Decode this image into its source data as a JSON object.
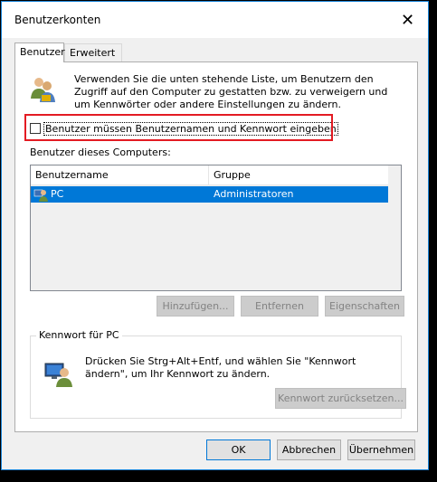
{
  "window": {
    "title": "Benutzerkonten"
  },
  "tabs": [
    {
      "label": "Benutzer"
    },
    {
      "label": "Erweitert"
    }
  ],
  "description": "Verwenden Sie die unten stehende Liste, um Benutzern den Zugriff auf den Computer zu gestatten bzw. zu verweigern und um Kennwörter oder andere Einstellungen zu ändern.",
  "checkbox": {
    "label": "Benutzer müssen Benutzernamen und Kennwort eingeben",
    "checked": false
  },
  "list": {
    "label": "Benutzer dieses Computers:",
    "columns": [
      "Benutzername",
      "Gruppe"
    ],
    "rows": [
      {
        "name": "PC",
        "group": "Administratoren"
      }
    ]
  },
  "list_buttons": {
    "add": "Hinzufügen...",
    "remove": "Entfernen",
    "properties": "Eigenschaften"
  },
  "password_group": {
    "title": "Kennwort für PC",
    "text": "Drücken Sie Strg+Alt+Entf, und wählen Sie \"Kennwort ändern\", um Ihr Kennwort zu ändern.",
    "reset_button": "Kennwort zurücksetzen..."
  },
  "dialog_buttons": {
    "ok": "OK",
    "cancel": "Abbrechen",
    "apply": "Übernehmen"
  },
  "colors": {
    "selection": "#0078d7",
    "highlight_box": "#e31b23"
  }
}
